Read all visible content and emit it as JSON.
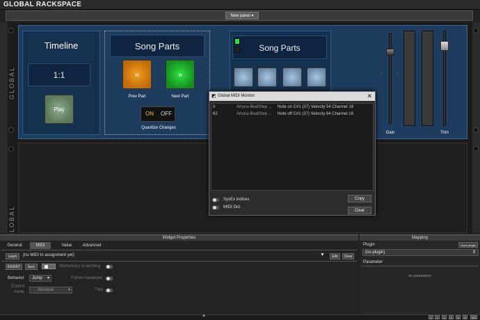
{
  "app": {
    "title": "GLOBAL RACKSPACE"
  },
  "panel_selector": {
    "label": "New panel",
    "arrow": "▾"
  },
  "rack": {
    "side_label": "GLOBAL",
    "lower_side_label": "GLOBAL",
    "timeline": {
      "title": "Timeline",
      "display": "1:1",
      "play_label": "Play"
    },
    "song_parts": {
      "title": "Song Parts",
      "prev_symbol": "«",
      "next_symbol": "»",
      "prev_label": "Prev Part",
      "next_label": "Next Part",
      "quantize_on": "ON",
      "quantize_off": "OFF",
      "quantize_label": "Quantize Changes"
    },
    "song_parts_right": {
      "title": "Song Parts"
    },
    "gain_label": "Gain",
    "trim_label": "Trim",
    "gain_level": 0.82,
    "trim_level": 0.88
  },
  "midi_monitor": {
    "title": "Global MIDI Monitor",
    "close_symbol": "✕",
    "rows": [
      {
        "index": "0",
        "source": "Arturia BeatStep ...",
        "message": "Note on C#1 (37) Velocity 54 Channel 16"
      },
      {
        "index": "62",
        "source": "Arturia BeatStep ...",
        "message": "Note off C#1 (37) Velocity 64 Channel 16"
      }
    ],
    "sysex_label": "SysEx indices",
    "midi_out_label": "MIDI Out",
    "copy_label": "Copy",
    "clear_label": "Clear"
  },
  "widget_properties": {
    "header": "Widget Properties",
    "tabs": [
      "General",
      "MIDI",
      "Value",
      "Advanced"
    ],
    "active_tab": "MIDI",
    "learn_label": "Learn",
    "assignment": "(no MIDI In assignment yet)",
    "edit_label": "Edit",
    "clear_label": "Clear",
    "invert_label": "INVERT",
    "sync_label": "Sync",
    "momentary_label": "Momentary to latching",
    "behavior_label": "Behavior",
    "behavior_value": "Jump",
    "follow_label": "Follow Hardware",
    "control_mode_label_1": "Control",
    "control_mode_label_2": "mode",
    "control_mode_value": "Absolute",
    "thru_label": "Thru"
  },
  "mapping": {
    "header": "Mapping",
    "plugin_label": "Plugin",
    "open_plugin_label": "Open plugin",
    "plugin_value": "(no plugin)",
    "parameter_label": "Parameter",
    "no_params": "no parameters"
  },
  "status": {
    "pages": [
      "1",
      "2",
      "3",
      "4",
      "5",
      "6",
      "INT"
    ]
  }
}
